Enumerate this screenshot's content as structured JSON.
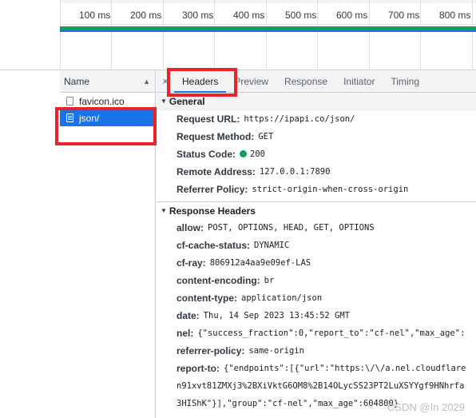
{
  "timeline": {
    "ticks": [
      "100 ms",
      "200 ms",
      "300 ms",
      "400 ms",
      "500 ms",
      "600 ms",
      "700 ms",
      "800 ms"
    ]
  },
  "name_panel": {
    "header": "Name",
    "requests": [
      {
        "name": "favicon.ico",
        "selected": false
      },
      {
        "name": "json/",
        "selected": true
      }
    ]
  },
  "tabs": {
    "close": "×",
    "items": [
      "Headers",
      "Preview",
      "Response",
      "Initiator",
      "Timing"
    ],
    "active": "Headers"
  },
  "general": {
    "title": "General",
    "rows": [
      {
        "key": "Request URL:",
        "value": "https://ipapi.co/json/"
      },
      {
        "key": "Request Method:",
        "value": "GET"
      },
      {
        "key": "Status Code:",
        "value": "200"
      },
      {
        "key": "Remote Address:",
        "value": "127.0.0.1:7890"
      },
      {
        "key": "Referrer Policy:",
        "value": "strict-origin-when-cross-origin"
      }
    ]
  },
  "response_headers": {
    "title": "Response Headers",
    "rows": [
      {
        "key": "allow:",
        "value": "POST, OPTIONS, HEAD, GET, OPTIONS"
      },
      {
        "key": "cf-cache-status:",
        "value": "DYNAMIC"
      },
      {
        "key": "cf-ray:",
        "value": "806912a4aa9e09ef-LAS"
      },
      {
        "key": "content-encoding:",
        "value": "br"
      },
      {
        "key": "content-type:",
        "value": "application/json"
      },
      {
        "key": "date:",
        "value": "Thu, 14 Sep 2023 13:45:52 GMT"
      },
      {
        "key": "nel:",
        "value": "{\"success_fraction\":0,\"report_to\":\"cf-nel\",\"max_age\":"
      },
      {
        "key": "referrer-policy:",
        "value": "same-origin"
      },
      {
        "key": "report-to:",
        "value": "{\"endpoints\":[{\"url\":\"https:\\/\\/a.nel.cloudflare"
      }
    ],
    "continuation": [
      "n91xvt81ZMXj3%2BXiVktG6OM8%2B14OLycSS23PT2LuXSYYgf9HNhrfa",
      "3HIShK\"}],\"group\":\"cf-nel\",\"max_age\":604800}"
    ]
  },
  "colors": {
    "accent": "#1a73e8",
    "annotation": "#e8232c",
    "status_ok": "#0f9d58"
  },
  "watermark": "CSDN @In 2029"
}
